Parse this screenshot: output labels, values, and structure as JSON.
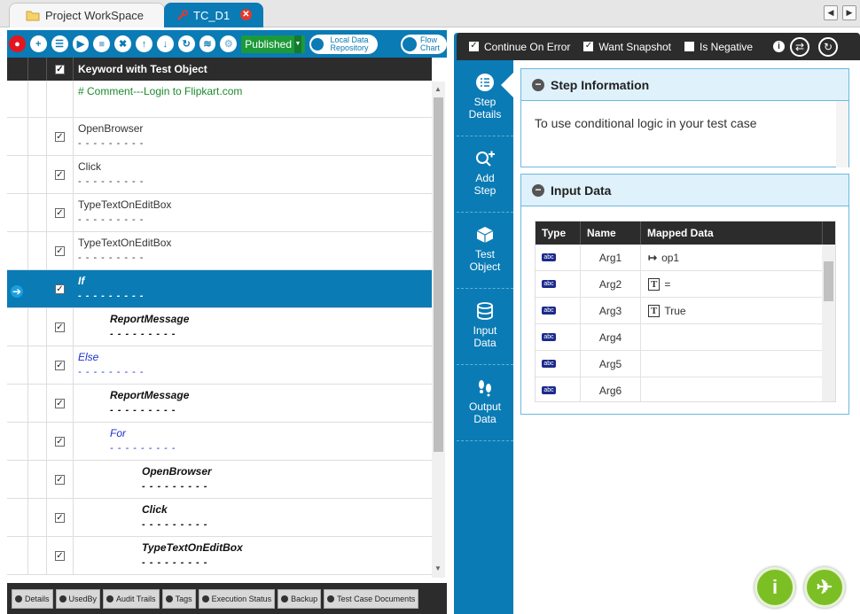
{
  "tabs": [
    {
      "label": "Project WorkSpace",
      "icon": "folder-icon"
    },
    {
      "label": "TC_D1",
      "icon": "wrench-icon"
    }
  ],
  "toolbar": {
    "status": "Published",
    "local_data_repository": "Local Data Repository",
    "flow_chart": "Flow Chart"
  },
  "grid": {
    "header": "Keyword with Test Object",
    "rows": [
      {
        "text": "# Comment---Login to Flipkart.com",
        "dashes": "",
        "style": "comment",
        "indent": 0
      },
      {
        "text": "OpenBrowser",
        "dashes": "- - - - - - - - -",
        "style": "normal",
        "indent": 0
      },
      {
        "text": "Click",
        "dashes": "- - - - - - - - -",
        "style": "normal",
        "indent": 0
      },
      {
        "text": "TypeTextOnEditBox",
        "dashes": "- - - - - - - - -",
        "style": "normal",
        "indent": 0
      },
      {
        "text": "TypeTextOnEditBox",
        "dashes": "- - - - - - - - -",
        "style": "normal",
        "indent": 0
      },
      {
        "text": "If",
        "dashes": "- - - - - - - - -",
        "style": "selected",
        "indent": 0
      },
      {
        "text": "ReportMessage",
        "dashes": "- - - - - - - - -",
        "style": "bold",
        "indent": 1
      },
      {
        "text": "Else",
        "dashes": "- - - - - - - - -",
        "style": "blue",
        "indent": 0
      },
      {
        "text": "ReportMessage",
        "dashes": "- - - - - - - - -",
        "style": "bold",
        "indent": 1
      },
      {
        "text": "For",
        "dashes": "- - - - - - - - -",
        "style": "blue",
        "indent": 1
      },
      {
        "text": "OpenBrowser",
        "dashes": "- - - - - - - - -",
        "style": "bold",
        "indent": 2
      },
      {
        "text": "Click",
        "dashes": "- - - - - - - - -",
        "style": "bold",
        "indent": 2
      },
      {
        "text": "TypeTextOnEditBox",
        "dashes": "- - - - - - - - -",
        "style": "bold",
        "indent": 2
      }
    ]
  },
  "bottom_tabs": [
    "Details",
    "UsedBy",
    "Audit Trails",
    "Tags",
    "Execution Status",
    "Backup",
    "Test Case Documents"
  ],
  "right_header": {
    "continue_on_error": "Continue On Error",
    "want_snapshot": "Want Snapshot",
    "is_negative": "Is Negative"
  },
  "side_nav": [
    {
      "label": "Step Details"
    },
    {
      "label": "Add Step"
    },
    {
      "label": "Test Object"
    },
    {
      "label": "Input Data"
    },
    {
      "label": "Output Data"
    }
  ],
  "step_info": {
    "title": "Step Information",
    "text": "To use conditional logic in your test case"
  },
  "input_data": {
    "title": "Input Data",
    "columns": [
      "Type",
      "Name",
      "Mapped Data"
    ],
    "type_badge": "abc",
    "rows": [
      {
        "name": "Arg1",
        "mapped": "op1",
        "mapped_icon": "output-arrow-icon"
      },
      {
        "name": "Arg2",
        "mapped": "=",
        "mapped_icon": "text-t-icon"
      },
      {
        "name": "Arg3",
        "mapped": "True",
        "mapped_icon": "text-t-icon"
      },
      {
        "name": "Arg4",
        "mapped": "",
        "mapped_icon": ""
      },
      {
        "name": "Arg5",
        "mapped": "",
        "mapped_icon": ""
      },
      {
        "name": "Arg6",
        "mapped": "",
        "mapped_icon": ""
      }
    ]
  }
}
